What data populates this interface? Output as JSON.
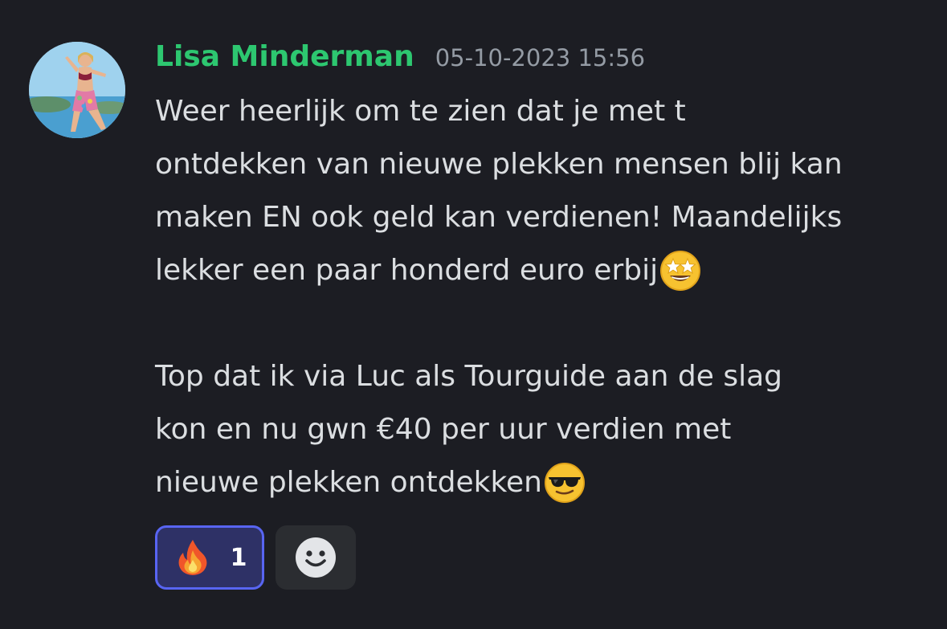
{
  "message": {
    "author": "Lisa Minderman",
    "timestamp": "05-10-2023 15:56",
    "author_color": "#2dc770",
    "avatar": "profile-photo-woman-beach",
    "lines": [
      "Weer heerlijk om te zien dat je met t",
      "ontdekken van nieuwe plekken mensen blij kan",
      "maken EN ook geld kan verdienen! Maandelijks",
      "lekker een paar honderd euro erbij",
      "",
      "Top dat ik via Luc als Tourguide aan de slag",
      "kon en nu gwn €40 per uur verdien met",
      "nieuwe plekken ontdekken"
    ],
    "inline_emojis": [
      "star-struck-emoji",
      "sunglasses-emoji"
    ]
  },
  "reactions": [
    {
      "emoji": "fire-emoji",
      "count": "1",
      "active": true,
      "accent": "#5865f2"
    }
  ],
  "add_reaction": {
    "icon": "smiley-face-icon"
  },
  "colors": {
    "background": "#1c1d23",
    "text": "#dbdee1",
    "muted": "#949ba4"
  }
}
